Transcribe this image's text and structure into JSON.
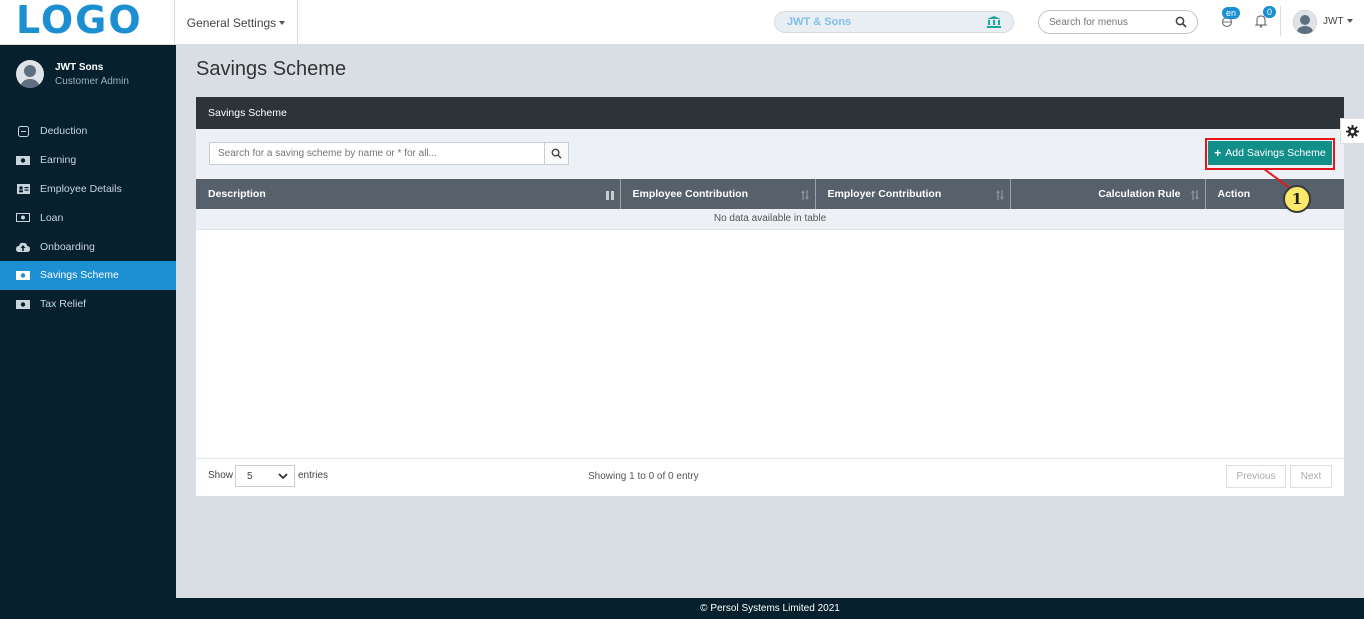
{
  "header": {
    "logo_text": "LOGO",
    "settings_menu": "General Settings",
    "company": "JWT & Sons",
    "search_placeholder": "Search for menus",
    "language_badge": "en",
    "notifications_count": "0",
    "user_short": "JWT"
  },
  "sidebar": {
    "profile_name": "JWT Sons",
    "profile_role": "Customer Admin",
    "items": [
      {
        "label": "Deduction",
        "icon": "minus-square-icon",
        "active": false
      },
      {
        "label": "Earning",
        "icon": "money-icon",
        "active": false
      },
      {
        "label": "Employee Details",
        "icon": "id-card-icon",
        "active": false
      },
      {
        "label": "Loan",
        "icon": "money-icon",
        "active": false
      },
      {
        "label": "Onboarding",
        "icon": "cloud-upload-icon",
        "active": false
      },
      {
        "label": "Savings Scheme",
        "icon": "money-icon",
        "active": true
      },
      {
        "label": "Tax Relief",
        "icon": "money-icon",
        "active": false
      }
    ]
  },
  "main": {
    "page_title": "Savings Scheme",
    "card_title": "Savings Scheme",
    "search_placeholder": "Search for a saving scheme by name or * for all...",
    "add_button": "Add Savings Scheme",
    "callout_number": "1",
    "columns": [
      "Description",
      "Employee Contribution",
      "Employer Contribution",
      "Calculation Rule",
      "Action"
    ],
    "empty_message": "No data available in table",
    "show_label": "Show",
    "page_size": "5",
    "entries_label": "entries",
    "info": "Showing 1 to 0 of 0 entry",
    "prev_label": "Previous",
    "next_label": "Next"
  },
  "footer": {
    "copyright": "© Persol Systems Limited 2021"
  },
  "colors": {
    "brand_blue": "#1b8fd2",
    "sidebar_bg": "#06202e",
    "add_button": "#138f8a",
    "header_dark": "#2c3339",
    "table_header": "#56616b",
    "highlight": "#e3171c",
    "callout": "#fde96a"
  }
}
